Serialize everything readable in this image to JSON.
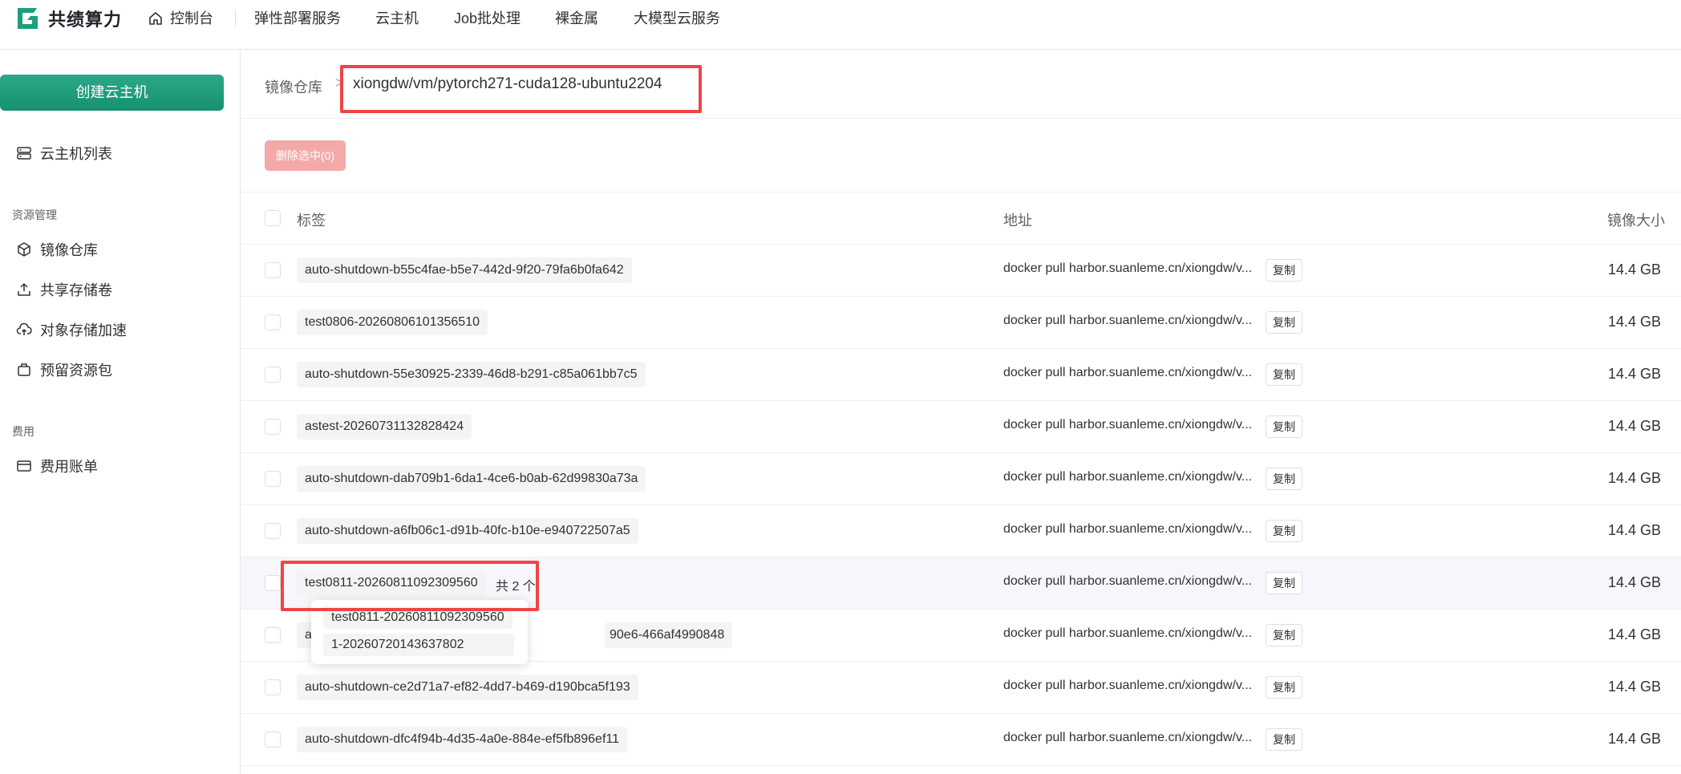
{
  "brand": {
    "name": "共绩算力"
  },
  "nav": {
    "home": "控制台",
    "items": [
      "弹性部署服务",
      "云主机",
      "Job批处理",
      "裸金属",
      "大模型云服务"
    ]
  },
  "sidebar": {
    "create_button": "创建云主机",
    "vm_list": "云主机列表",
    "group_resources": "资源管理",
    "image_repo": "镜像仓库",
    "shared_storage": "共享存储卷",
    "object_storage": "对象存储加速",
    "reserved_pkg": "预留资源包",
    "group_billing": "费用",
    "billing": "费用账单"
  },
  "breadcrumb": {
    "root": "镜像仓库",
    "sep": ">",
    "current": "xiongdw/vm/pytorch271-cuda128-ubuntu2204"
  },
  "toolbar": {
    "delete_selected": "删除选中(0)"
  },
  "table": {
    "headers": {
      "tag": "标签",
      "address": "地址",
      "size": "镜像大小"
    },
    "copy_label": "复制",
    "rows": [
      {
        "tag": "auto-shutdown-b55c4fae-b5e7-442d-9f20-79fa6b0fa642",
        "addr": "docker pull harbor.suanleme.cn/xiongdw/v...",
        "size": "14.4 GB"
      },
      {
        "tag": "test0806-20260806101356510",
        "addr": "docker pull harbor.suanleme.cn/xiongdw/v...",
        "size": "14.4 GB"
      },
      {
        "tag": "auto-shutdown-55e30925-2339-46d8-b291-c85a061bb7c5",
        "addr": "docker pull harbor.suanleme.cn/xiongdw/v...",
        "size": "14.4 GB"
      },
      {
        "tag": "astest-20260731132828424",
        "addr": "docker pull harbor.suanleme.cn/xiongdw/v...",
        "size": "14.4 GB"
      },
      {
        "tag": "auto-shutdown-dab709b1-6da1-4ce6-b0ab-62d99830a73a",
        "addr": "docker pull harbor.suanleme.cn/xiongdw/v...",
        "size": "14.4 GB"
      },
      {
        "tag": "auto-shutdown-a6fb06c1-d91b-40fc-b10e-e940722507a5",
        "addr": "docker pull harbor.suanleme.cn/xiongdw/v...",
        "size": "14.4 GB"
      },
      {
        "tag": "test0811-20260811092309560",
        "more": "共 2 个",
        "addr": "docker pull harbor.suanleme.cn/xiongdw/v...",
        "size": "14.4 GB"
      },
      {
        "tag": "a",
        "tag_tail": "90e6-466af4990848",
        "addr": "docker pull harbor.suanleme.cn/xiongdw/v...",
        "size": "14.4 GB"
      },
      {
        "tag": "auto-shutdown-ce2d71a7-ef82-4dd7-b469-d190bca5f193",
        "addr": "docker pull harbor.suanleme.cn/xiongdw/v...",
        "size": "14.4 GB"
      },
      {
        "tag": "auto-shutdown-dfc4f94b-4d35-4a0e-884e-ef5fb896ef11",
        "addr": "docker pull harbor.suanleme.cn/xiongdw/v...",
        "size": "14.4 GB"
      }
    ]
  },
  "popover": {
    "tags": [
      "test0811-20260811092309560",
      "1-20260720143637802"
    ]
  },
  "colors": {
    "accent": "#1f9e7e",
    "highlight": "#ef4444",
    "danger_disabled": "#f4a9a9"
  }
}
